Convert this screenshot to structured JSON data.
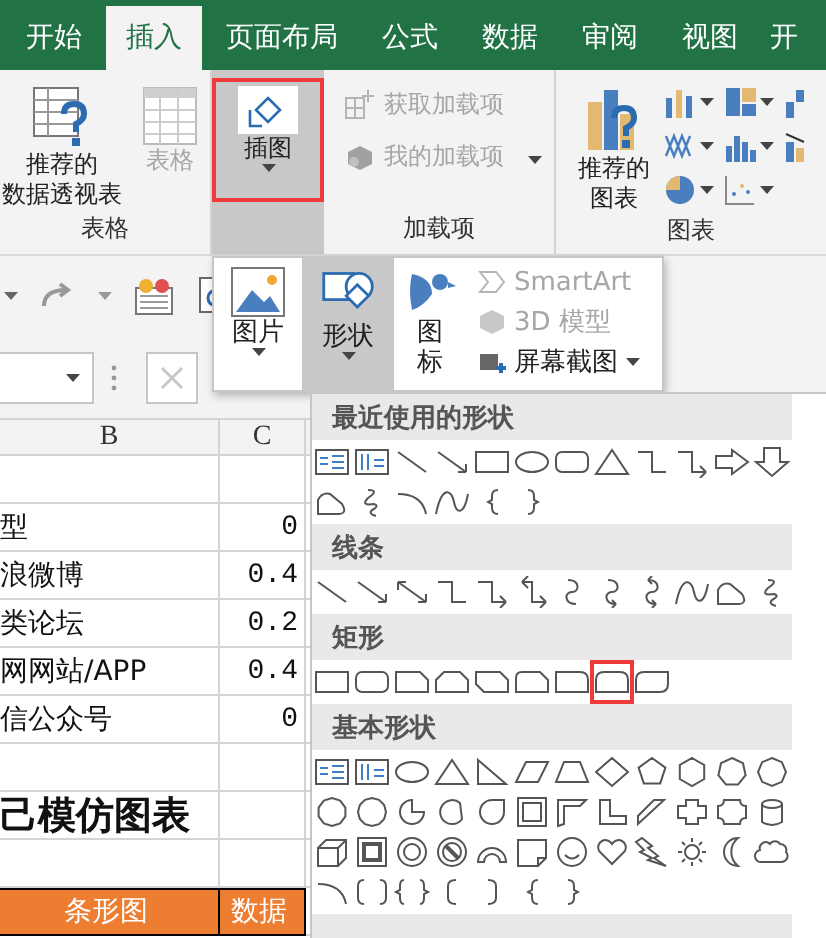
{
  "tabs": [
    {
      "label": "开始",
      "selected": false
    },
    {
      "label": "插入",
      "selected": true
    },
    {
      "label": "页面布局",
      "selected": false
    },
    {
      "label": "公式",
      "selected": false
    },
    {
      "label": "数据",
      "selected": false
    },
    {
      "label": "审阅",
      "selected": false
    },
    {
      "label": "视图",
      "selected": false
    },
    {
      "label": "开",
      "selected": false
    }
  ],
  "ribbon": {
    "table_group": {
      "label": "表格",
      "pivot_button": {
        "lines": [
          "推荐的",
          "数据透视表"
        ]
      },
      "table_button": {
        "label": "表格",
        "disabled": true
      }
    },
    "illustrations_button": {
      "label": "插图",
      "expanded": true,
      "highlighted": true
    },
    "addins_group": {
      "label": "加载项",
      "buttons": [
        {
          "label": "获取加载项",
          "disabled": true,
          "has_caret": false
        },
        {
          "label": "我的加载项",
          "disabled": true,
          "has_caret": true
        }
      ]
    },
    "charts_group": {
      "label": "图表",
      "recommended_button": {
        "lines": [
          "推荐的",
          "图表"
        ]
      }
    }
  },
  "illustrations_menu": {
    "items": [
      {
        "label": "图片",
        "selected": false
      },
      {
        "label": "形状",
        "selected": true
      },
      {
        "label": "图标",
        "selected": false
      }
    ],
    "side_items": [
      {
        "label": "SmartArt",
        "disabled": true,
        "has_caret": false
      },
      {
        "label": "3D 模型",
        "disabled": true,
        "has_caret": false
      },
      {
        "label": "屏幕截图",
        "disabled": false,
        "has_caret": true
      }
    ]
  },
  "sheet": {
    "columns": [
      "B",
      "C"
    ],
    "rows": [
      {
        "kind": "blank"
      },
      {
        "kind": "data",
        "label": "型",
        "value": "0"
      },
      {
        "kind": "data",
        "label": "浪微博",
        "value": "0.4"
      },
      {
        "kind": "data",
        "label": "类论坛",
        "value": "0.2"
      },
      {
        "kind": "data",
        "label": "网网站/APP",
        "value": "0.4"
      },
      {
        "kind": "data",
        "label": "信公众号",
        "value": "0"
      },
      {
        "kind": "blank"
      },
      {
        "kind": "title",
        "label": "己模仿图表"
      },
      {
        "kind": "blank"
      },
      {
        "kind": "header",
        "label": "条形图",
        "value": "数据"
      }
    ]
  },
  "shapes_gallery": {
    "sections": [
      {
        "title": "最近使用的形状",
        "shapes": [
          {
            "kind": "textbox",
            "selected": false
          },
          {
            "kind": "vtextbox",
            "selected": false
          },
          {
            "kind": "line",
            "selected": false
          },
          {
            "kind": "arrowline",
            "selected": false
          },
          {
            "kind": "rect",
            "selected": false
          },
          {
            "kind": "ellipse",
            "selected": false
          },
          {
            "kind": "roundrect",
            "selected": false
          },
          {
            "kind": "triangle",
            "selected": false
          },
          {
            "kind": "elbow",
            "selected": false
          },
          {
            "kind": "elbowarrow",
            "selected": false
          },
          {
            "kind": "rightarrow",
            "selected": false
          },
          {
            "kind": "downarrow",
            "selected": false
          },
          {
            "kind": "freeform",
            "selected": false
          },
          {
            "kind": "scribble",
            "selected": false
          },
          {
            "kind": "arc",
            "selected": false
          },
          {
            "kind": "curve",
            "selected": false
          },
          {
            "kind": "lbrace",
            "selected": false
          },
          {
            "kind": "rbrace",
            "selected": false
          }
        ]
      },
      {
        "title": "线条",
        "shapes": [
          {
            "kind": "line",
            "selected": false
          },
          {
            "kind": "arrowline",
            "selected": false
          },
          {
            "kind": "dblarrow",
            "selected": false
          },
          {
            "kind": "elbow",
            "selected": false
          },
          {
            "kind": "elbowarrow",
            "selected": false
          },
          {
            "kind": "elbowdbl",
            "selected": false
          },
          {
            "kind": "curved",
            "selected": false
          },
          {
            "kind": "curvedarrow",
            "selected": false
          },
          {
            "kind": "curveddbl",
            "selected": false
          },
          {
            "kind": "curve",
            "selected": false
          },
          {
            "kind": "freeform",
            "selected": false
          },
          {
            "kind": "scribble",
            "selected": false
          }
        ]
      },
      {
        "title": "矩形",
        "shapes": [
          {
            "kind": "rect",
            "selected": false
          },
          {
            "kind": "roundrect",
            "selected": false
          },
          {
            "kind": "snip1",
            "selected": false
          },
          {
            "kind": "snipsame",
            "selected": false
          },
          {
            "kind": "snipdiag",
            "selected": false
          },
          {
            "kind": "sniproundtop",
            "selected": false
          },
          {
            "kind": "round1",
            "selected": false
          },
          {
            "kind": "round2",
            "selected": true
          },
          {
            "kind": "rounddiag",
            "selected": false
          }
        ]
      },
      {
        "title": "基本形状",
        "shapes": [
          {
            "kind": "textbox",
            "selected": false
          },
          {
            "kind": "vtextbox",
            "selected": false
          },
          {
            "kind": "ellipse",
            "selected": false
          },
          {
            "kind": "triangle",
            "selected": false
          },
          {
            "kind": "rtriangle",
            "selected": false
          },
          {
            "kind": "parallelogram",
            "selected": false
          },
          {
            "kind": "trapezoid",
            "selected": false
          },
          {
            "kind": "diamond",
            "selected": false
          },
          {
            "kind": "pentagon",
            "selected": false
          },
          {
            "kind": "hexagon",
            "selected": false
          },
          {
            "kind": "heptagon",
            "selected": false
          },
          {
            "kind": "octagon",
            "selected": false
          },
          {
            "kind": "decagon",
            "selected": false
          },
          {
            "kind": "dodecagon",
            "selected": false
          },
          {
            "kind": "pie",
            "selected": false
          },
          {
            "kind": "chord",
            "selected": false
          },
          {
            "kind": "teardrop",
            "selected": false
          },
          {
            "kind": "frame",
            "selected": false
          },
          {
            "kind": "halfframe",
            "selected": false
          },
          {
            "kind": "lshape",
            "selected": false
          },
          {
            "kind": "diagstripe",
            "selected": false
          },
          {
            "kind": "cross",
            "selected": false
          },
          {
            "kind": "plaque",
            "selected": false
          },
          {
            "kind": "can",
            "selected": false
          },
          {
            "kind": "cube",
            "selected": false
          },
          {
            "kind": "bevel",
            "selected": false
          },
          {
            "kind": "donut",
            "selected": false
          },
          {
            "kind": "nosymbol",
            "selected": false
          },
          {
            "kind": "blockarc",
            "selected": false
          },
          {
            "kind": "foldedcorner",
            "selected": false
          },
          {
            "kind": "smiley",
            "selected": false
          },
          {
            "kind": "heart",
            "selected": false
          },
          {
            "kind": "lightning",
            "selected": false
          },
          {
            "kind": "sun",
            "selected": false
          },
          {
            "kind": "moon",
            "selected": false
          },
          {
            "kind": "cloud",
            "selected": false
          },
          {
            "kind": "arc",
            "selected": false
          },
          {
            "kind": "bracketpair",
            "selected": false
          },
          {
            "kind": "bracepair",
            "selected": false
          },
          {
            "kind": "lbracket",
            "selected": false
          },
          {
            "kind": "rbracket",
            "selected": false
          },
          {
            "kind": "lbrace",
            "selected": false
          },
          {
            "kind": "rbrace",
            "selected": false
          }
        ]
      }
    ]
  }
}
